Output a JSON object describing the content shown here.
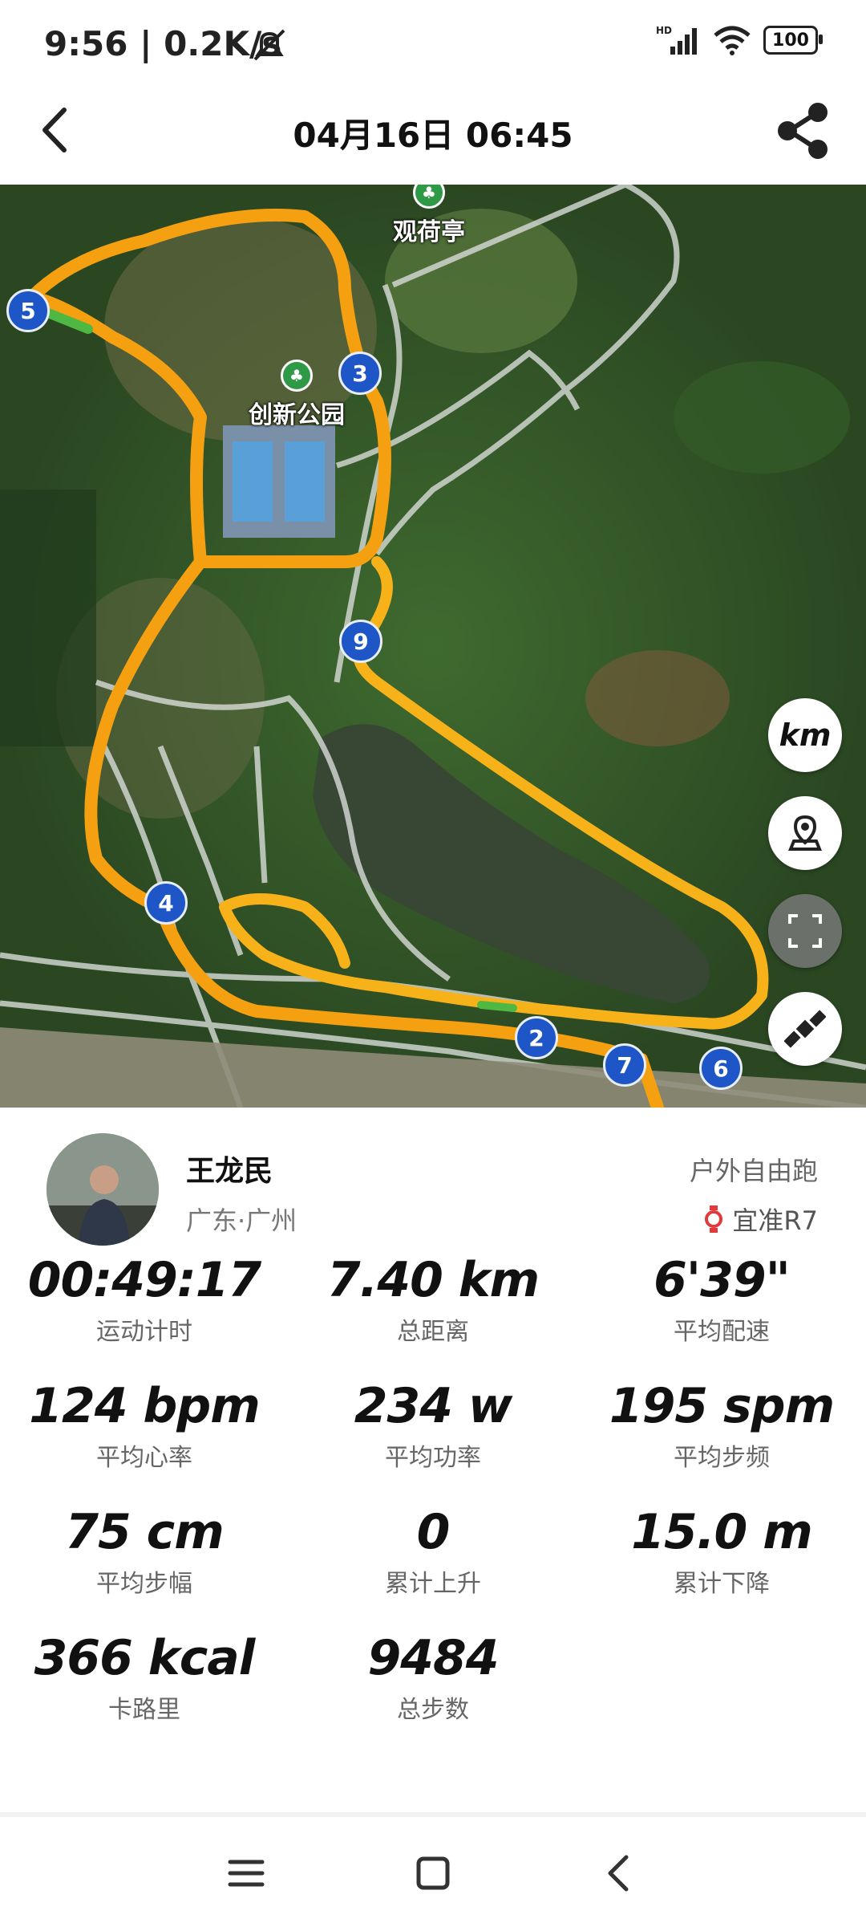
{
  "status_bar": {
    "time": "9:56",
    "net_speed": "0.2K/s",
    "battery": "100"
  },
  "header": {
    "title": "04月16日 06:45"
  },
  "map": {
    "poi": [
      {
        "label": "观荷亭"
      },
      {
        "label": "创新公园"
      }
    ],
    "km_markers": [
      "5",
      "3",
      "9",
      "4",
      "2",
      "7",
      "6"
    ],
    "unit_button": "km",
    "route_color": "#f5a011"
  },
  "profile": {
    "name": "王龙民",
    "location": "广东·广州",
    "activity_type": "户外自由跑",
    "device": "宜准R7"
  },
  "stats": [
    {
      "value": "00:49:17",
      "label": "运动计时"
    },
    {
      "value": "7.40 km",
      "label": "总距离"
    },
    {
      "value": "6'39\"",
      "label": "平均配速"
    },
    {
      "value": "124 bpm",
      "label": "平均心率"
    },
    {
      "value": "234 w",
      "label": "平均功率"
    },
    {
      "value": "195 spm",
      "label": "平均步频"
    },
    {
      "value": "75 cm",
      "label": "平均步幅"
    },
    {
      "value": "0",
      "label": "累计上升"
    },
    {
      "value": "15.0 m",
      "label": "累计下降"
    },
    {
      "value": "366 kcal",
      "label": "卡路里"
    },
    {
      "value": "9484",
      "label": "总步数"
    }
  ]
}
